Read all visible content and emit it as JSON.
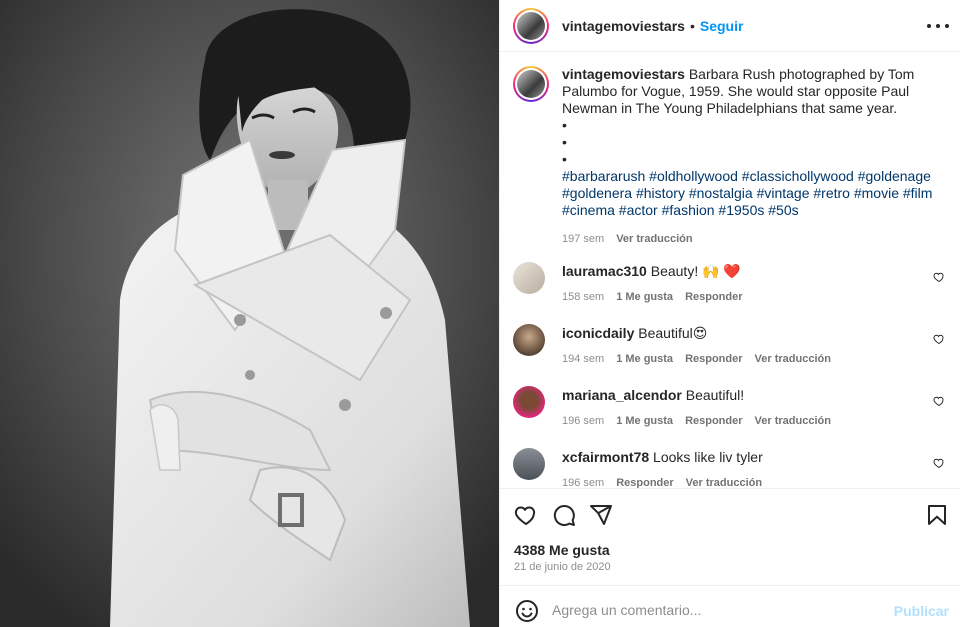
{
  "post": {
    "username": "vintagemoviestars",
    "follow_label": "Seguir",
    "separator": "•",
    "caption_text": "Barbara Rush photographed by Tom Palumbo for Vogue, 1959. She would star opposite Paul Newman in The Young Philadelphians that same year.",
    "bullets": [
      "•",
      "•",
      "•"
    ],
    "hashtags": "#barbararush #oldhollywood #classichollywood #goldenage #goldenera #history #nostalgia #vintage #retro #movie #film #cinema #actor #fashion #1950s #50s",
    "caption_time": "197 sem",
    "caption_translate": "Ver traducción"
  },
  "comments": [
    {
      "user": "lauramac310",
      "text": "Beauty! 🙌 ❤️",
      "time": "158 sem",
      "likes": "1 Me gusta",
      "reply": "Responder",
      "translate": ""
    },
    {
      "user": "iconicdaily",
      "text": "Beautiful😍",
      "time": "194 sem",
      "likes": "1 Me gusta",
      "reply": "Responder",
      "translate": "Ver traducción"
    },
    {
      "user": "mariana_alcendor",
      "text": "Beautiful!",
      "time": "196 sem",
      "likes": "1 Me gusta",
      "reply": "Responder",
      "translate": "Ver traducción"
    },
    {
      "user": "xcfairmont78",
      "text": "Looks like liv tyler",
      "time": "196 sem",
      "likes": "",
      "reply": "Responder",
      "translate": "Ver traducción"
    }
  ],
  "footer": {
    "likes_count": "4388 Me gusta",
    "date": "21 de junio de 2020",
    "comment_placeholder": "Agrega un comentario...",
    "publish_label": "Publicar"
  },
  "colors": {
    "accent": "#0095f6",
    "hashtag": "#00376b",
    "muted": "#8e8e8e",
    "publish_disabled": "#b2dffc"
  }
}
